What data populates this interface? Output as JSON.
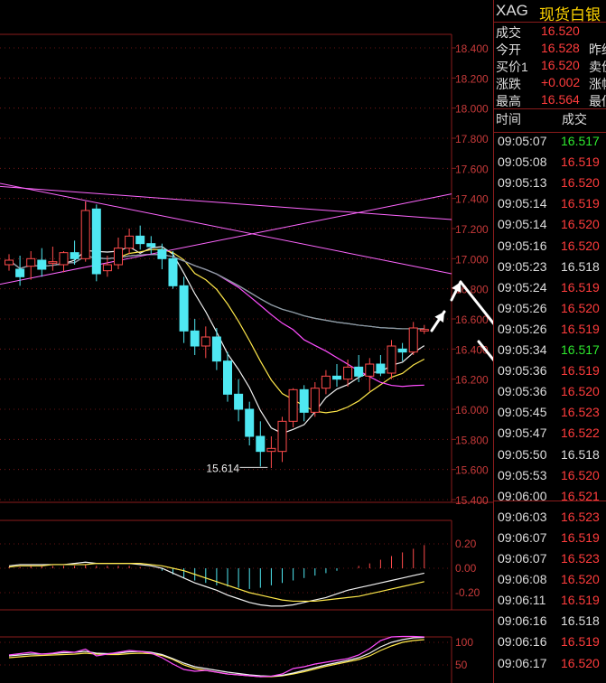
{
  "colors": {
    "up": "#ff3c3c",
    "down": "#2ee82e",
    "flat": "#dddddd",
    "accent": "#ffd400",
    "grid": "#8a1c1c"
  },
  "header": {
    "code": "XAG",
    "name": "现货白银"
  },
  "quote": [
    {
      "label": "成交",
      "value": "16.520",
      "color": "up",
      "extra": ""
    },
    {
      "label": "今开",
      "value": "16.528",
      "color": "up",
      "extra": "昨结"
    },
    {
      "label": "买价1",
      "value": "16.520",
      "color": "up",
      "extra": "卖价"
    },
    {
      "label": "涨跌",
      "value": "+0.002",
      "color": "up",
      "extra": "涨幅"
    },
    {
      "label": "最高",
      "value": "16.564",
      "color": "up",
      "extra": "最低"
    }
  ],
  "ticks_header": {
    "time": "时间",
    "price": "成交"
  },
  "ticks": [
    {
      "time": "09:05:07",
      "price": "16.517",
      "color": "down"
    },
    {
      "time": "09:05:08",
      "price": "16.519",
      "color": "up"
    },
    {
      "time": "09:05:13",
      "price": "16.520",
      "color": "up"
    },
    {
      "time": "09:05:14",
      "price": "16.519",
      "color": "up"
    },
    {
      "time": "09:05:14",
      "price": "16.520",
      "color": "up"
    },
    {
      "time": "09:05:16",
      "price": "16.520",
      "color": "up"
    },
    {
      "time": "09:05:23",
      "price": "16.518",
      "color": "flat"
    },
    {
      "time": "09:05:24",
      "price": "16.519",
      "color": "up"
    },
    {
      "time": "09:05:26",
      "price": "16.520",
      "color": "up"
    },
    {
      "time": "09:05:26",
      "price": "16.519",
      "color": "up"
    },
    {
      "time": "09:05:34",
      "price": "16.517",
      "color": "down"
    },
    {
      "time": "09:05:36",
      "price": "16.519",
      "color": "up"
    },
    {
      "time": "09:05:36",
      "price": "16.520",
      "color": "up"
    },
    {
      "time": "09:05:45",
      "price": "16.523",
      "color": "up"
    },
    {
      "time": "09:05:47",
      "price": "16.522",
      "color": "up"
    },
    {
      "time": "09:05:50",
      "price": "16.518",
      "color": "flat"
    },
    {
      "time": "09:05:53",
      "price": "16.520",
      "color": "up"
    },
    {
      "time": "09:06:00",
      "price": "16.521",
      "color": "up"
    },
    {
      "time": "09:06:03",
      "price": "16.523",
      "color": "up"
    },
    {
      "time": "09:06:07",
      "price": "16.519",
      "color": "up"
    },
    {
      "time": "09:06:07",
      "price": "16.523",
      "color": "up"
    },
    {
      "time": "09:06:08",
      "price": "16.520",
      "color": "up"
    },
    {
      "time": "09:06:11",
      "price": "16.519",
      "color": "up"
    },
    {
      "time": "09:06:16",
      "price": "16.518",
      "color": "flat"
    },
    {
      "time": "09:06:16",
      "price": "16.519",
      "color": "up"
    },
    {
      "time": "09:06:17",
      "price": "16.520",
      "color": "up"
    }
  ],
  "chart_data": {
    "type": "candlestick",
    "price_axis": {
      "ticks": [
        "18.400",
        "18.200",
        "18.000",
        "17.800",
        "17.600",
        "17.400",
        "17.200",
        "17.000",
        "16.800",
        "16.600",
        "16.400",
        "16.200",
        "16.000",
        "15.800",
        "15.600",
        "15.400"
      ],
      "ylim": [
        15.4,
        18.5
      ]
    },
    "candles": [
      {
        "o": 16.96,
        "h": 17.03,
        "l": 16.92,
        "c": 16.99
      },
      {
        "o": 16.93,
        "h": 17.02,
        "l": 16.82,
        "c": 16.88
      },
      {
        "o": 16.95,
        "h": 17.05,
        "l": 16.86,
        "c": 17.0
      },
      {
        "o": 16.99,
        "h": 17.07,
        "l": 16.88,
        "c": 16.93
      },
      {
        "o": 16.97,
        "h": 17.08,
        "l": 16.92,
        "c": 16.98
      },
      {
        "o": 16.96,
        "h": 17.05,
        "l": 16.91,
        "c": 17.04
      },
      {
        "o": 17.04,
        "h": 17.12,
        "l": 16.96,
        "c": 17.0
      },
      {
        "o": 17.0,
        "h": 17.38,
        "l": 16.98,
        "c": 17.32
      },
      {
        "o": 17.33,
        "h": 17.36,
        "l": 16.85,
        "c": 16.9
      },
      {
        "o": 16.92,
        "h": 17.02,
        "l": 16.88,
        "c": 16.96
      },
      {
        "o": 16.96,
        "h": 17.14,
        "l": 16.93,
        "c": 17.07
      },
      {
        "o": 17.07,
        "h": 17.2,
        "l": 17.03,
        "c": 17.15
      },
      {
        "o": 17.15,
        "h": 17.22,
        "l": 17.06,
        "c": 17.1
      },
      {
        "o": 17.1,
        "h": 17.15,
        "l": 17.03,
        "c": 17.08
      },
      {
        "o": 17.06,
        "h": 17.1,
        "l": 16.93,
        "c": 17.0
      },
      {
        "o": 17.0,
        "h": 17.05,
        "l": 16.8,
        "c": 16.82
      },
      {
        "o": 16.82,
        "h": 16.88,
        "l": 16.44,
        "c": 16.52
      },
      {
        "o": 16.52,
        "h": 16.6,
        "l": 16.36,
        "c": 16.42
      },
      {
        "o": 16.42,
        "h": 16.55,
        "l": 16.34,
        "c": 16.48
      },
      {
        "o": 16.48,
        "h": 16.54,
        "l": 16.26,
        "c": 16.32
      },
      {
        "o": 16.32,
        "h": 16.38,
        "l": 16.05,
        "c": 16.1
      },
      {
        "o": 16.1,
        "h": 16.2,
        "l": 15.92,
        "c": 16.0
      },
      {
        "o": 16.0,
        "h": 16.05,
        "l": 15.76,
        "c": 15.82
      },
      {
        "o": 15.82,
        "h": 15.92,
        "l": 15.62,
        "c": 15.72
      },
      {
        "o": 15.72,
        "h": 15.82,
        "l": 15.61,
        "c": 15.74
      },
      {
        "o": 15.72,
        "h": 15.95,
        "l": 15.65,
        "c": 15.92
      },
      {
        "o": 15.92,
        "h": 16.14,
        "l": 15.88,
        "c": 16.13
      },
      {
        "o": 16.13,
        "h": 16.16,
        "l": 15.92,
        "c": 15.98
      },
      {
        "o": 15.98,
        "h": 16.18,
        "l": 15.95,
        "c": 16.14
      },
      {
        "o": 16.14,
        "h": 16.26,
        "l": 16.1,
        "c": 16.22
      },
      {
        "o": 16.22,
        "h": 16.3,
        "l": 16.15,
        "c": 16.2
      },
      {
        "o": 16.2,
        "h": 16.33,
        "l": 16.15,
        "c": 16.28
      },
      {
        "o": 16.28,
        "h": 16.36,
        "l": 16.18,
        "c": 16.22
      },
      {
        "o": 16.22,
        "h": 16.34,
        "l": 16.12,
        "c": 16.3
      },
      {
        "o": 16.3,
        "h": 16.36,
        "l": 16.22,
        "c": 16.24
      },
      {
        "o": 16.24,
        "h": 16.46,
        "l": 16.2,
        "c": 16.42
      },
      {
        "o": 16.4,
        "h": 16.44,
        "l": 16.32,
        "c": 16.38
      },
      {
        "o": 16.38,
        "h": 16.58,
        "l": 16.36,
        "c": 16.54
      },
      {
        "o": 16.52,
        "h": 16.56,
        "l": 16.5,
        "c": 16.53
      }
    ],
    "annotations": [
      {
        "text": "15.614",
        "candle": 24,
        "value": 15.614
      }
    ],
    "macd": {
      "ticks": [
        "0.20",
        "0.00",
        "-0.20"
      ],
      "ylim": [
        -0.4,
        0.4
      ],
      "hist": [
        0.01,
        0.01,
        0.02,
        0.02,
        0.02,
        0.02,
        0.02,
        0.03,
        0.02,
        0.02,
        0.02,
        0.02,
        0.01,
        0.0,
        -0.02,
        -0.05,
        -0.08,
        -0.1,
        -0.12,
        -0.14,
        -0.15,
        -0.16,
        -0.17,
        -0.16,
        -0.14,
        -0.12,
        -0.1,
        -0.08,
        -0.06,
        -0.04,
        -0.02,
        0.0,
        0.02,
        0.04,
        0.07,
        0.1,
        0.13,
        0.16,
        0.19
      ],
      "dif": [
        0.02,
        0.03,
        0.03,
        0.03,
        0.03,
        0.03,
        0.04,
        0.05,
        0.04,
        0.04,
        0.04,
        0.04,
        0.03,
        0.02,
        0.0,
        -0.04,
        -0.08,
        -0.12,
        -0.15,
        -0.18,
        -0.22,
        -0.25,
        -0.28,
        -0.3,
        -0.31,
        -0.31,
        -0.3,
        -0.28,
        -0.26,
        -0.24,
        -0.21,
        -0.18,
        -0.16,
        -0.14,
        -0.12,
        -0.1,
        -0.08,
        -0.06,
        -0.04
      ],
      "dea": [
        0.01,
        0.02,
        0.02,
        0.02,
        0.03,
        0.03,
        0.03,
        0.03,
        0.04,
        0.04,
        0.04,
        0.04,
        0.04,
        0.03,
        0.02,
        0.0,
        -0.02,
        -0.05,
        -0.08,
        -0.11,
        -0.14,
        -0.17,
        -0.2,
        -0.22,
        -0.24,
        -0.26,
        -0.27,
        -0.27,
        -0.27,
        -0.26,
        -0.25,
        -0.24,
        -0.23,
        -0.21,
        -0.19,
        -0.17,
        -0.15,
        -0.13,
        -0.11
      ]
    },
    "osc": {
      "ticks": [
        "100",
        "50"
      ],
      "ylim": [
        30,
        130
      ],
      "k": [
        72,
        75,
        78,
        74,
        76,
        80,
        78,
        85,
        70,
        74,
        78,
        82,
        80,
        76,
        66,
        52,
        40,
        36,
        38,
        34,
        30,
        28,
        26,
        24,
        25,
        30,
        42,
        46,
        52,
        56,
        60,
        64,
        72,
        86,
        104,
        112,
        113,
        113,
        112
      ],
      "d": [
        70,
        72,
        74,
        74,
        75,
        77,
        78,
        80,
        76,
        75,
        76,
        79,
        80,
        78,
        73,
        64,
        54,
        46,
        42,
        38,
        34,
        31,
        28,
        26,
        25,
        27,
        32,
        38,
        44,
        50,
        55,
        60,
        66,
        76,
        90,
        100,
        106,
        110,
        111
      ],
      "j": [
        66,
        68,
        70,
        71,
        72,
        73,
        74,
        76,
        74,
        73,
        73,
        75,
        76,
        75,
        71,
        62,
        50,
        42,
        38,
        34,
        30,
        28,
        26,
        24,
        24,
        26,
        30,
        35,
        41,
        47,
        52,
        57,
        62,
        70,
        82,
        92,
        100,
        104,
        106
      ]
    }
  }
}
